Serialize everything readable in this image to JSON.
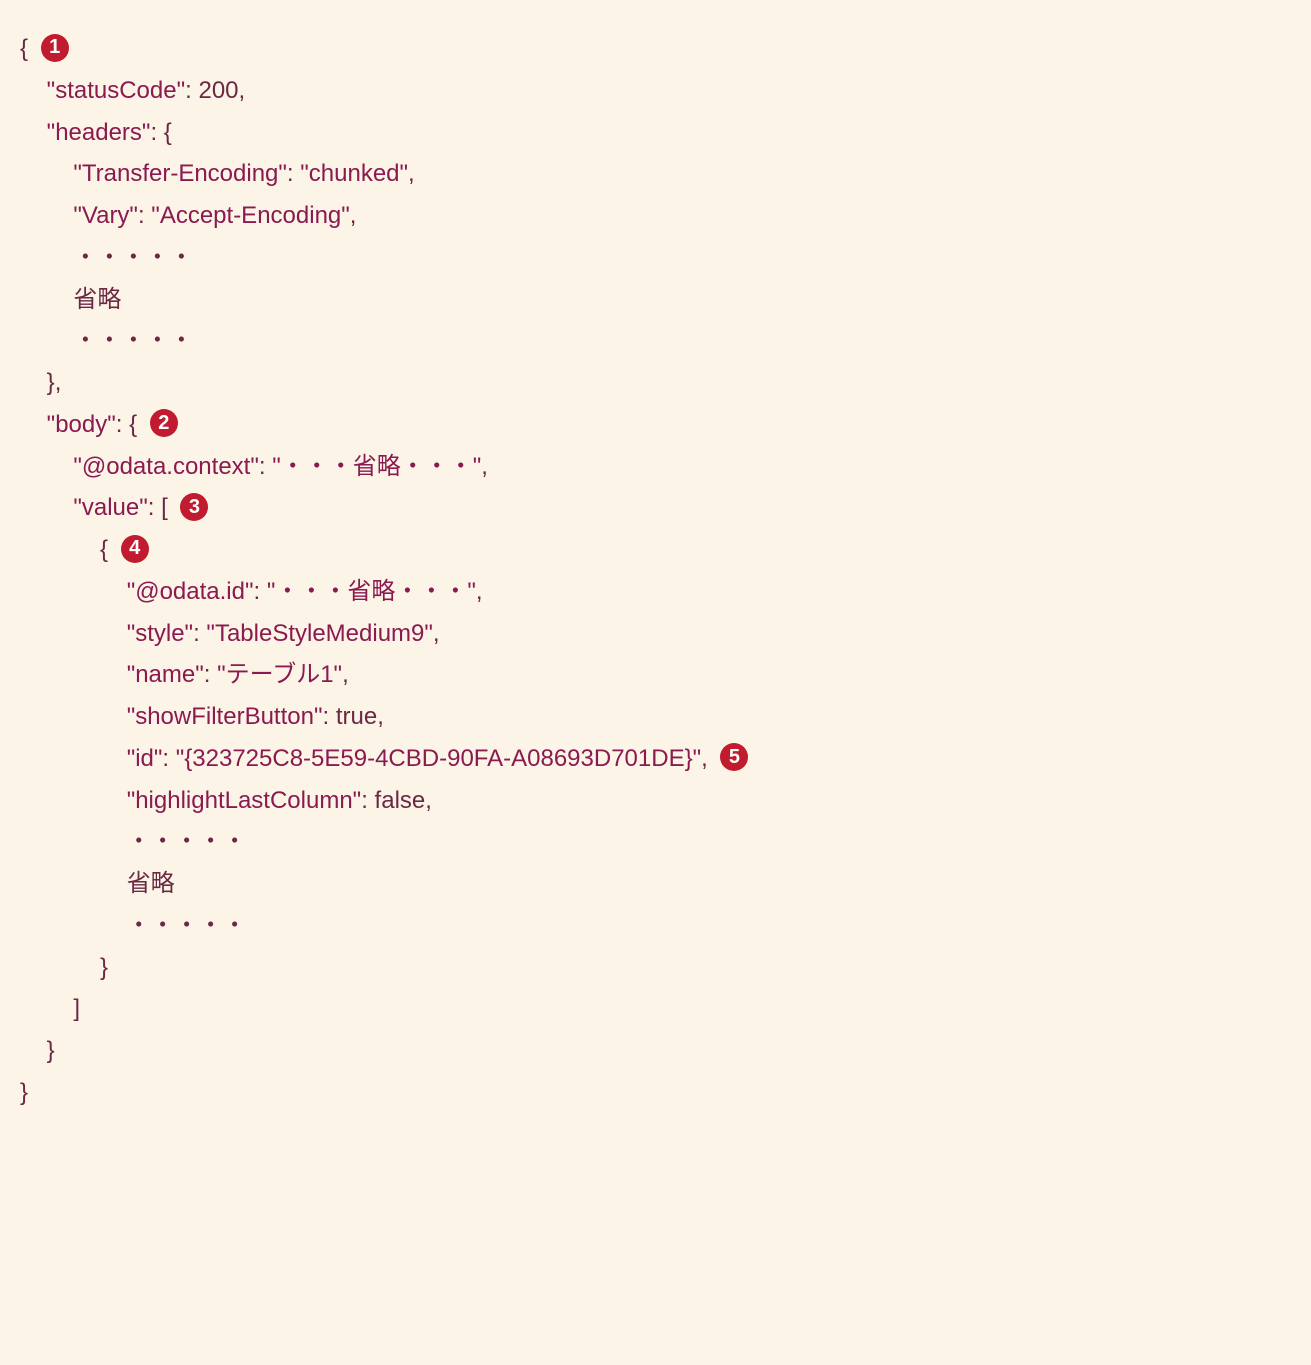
{
  "badges": {
    "b1": "1",
    "b2": "2",
    "b3": "3",
    "b4": "4",
    "b5": "5"
  },
  "t": {
    "openBrace": "{",
    "closeBrace": "}",
    "openBracket": "[",
    "closeBracket": "]",
    "comma": ",",
    "colon": ": ",
    "statusCodeKey": "\"statusCode\"",
    "statusCodeVal": "200",
    "headersKey": "\"headers\"",
    "transferEncodingKey": "\"Transfer-Encoding\"",
    "transferEncodingVal": "\"chunked\"",
    "varyKey": "\"Vary\"",
    "varyVal": "\"Accept-Encoding\"",
    "dots": "・・・・・",
    "omit": "省略",
    "bodyKey": "\"body\"",
    "odataContextKey": "\"@odata.context\"",
    "odataContextVal": "\"・・・省略・・・\"",
    "valueKey": "\"value\"",
    "odataIdKey": "\"@odata.id\"",
    "odataIdVal": "\"・・・省略・・・\"",
    "styleKey": "\"style\"",
    "styleVal": "\"TableStyleMedium9\"",
    "nameKey": "\"name\"",
    "nameVal": "\"テーブル1\"",
    "showFilterKey": "\"showFilterButton\"",
    "trueVal": "true",
    "idKey": "\"id\"",
    "idVal": "\"{323725C8-5E59-4CBD-90FA-A08693D701DE}\"",
    "highlightKey": "\"highlightLastColumn\"",
    "falseVal": "false"
  }
}
